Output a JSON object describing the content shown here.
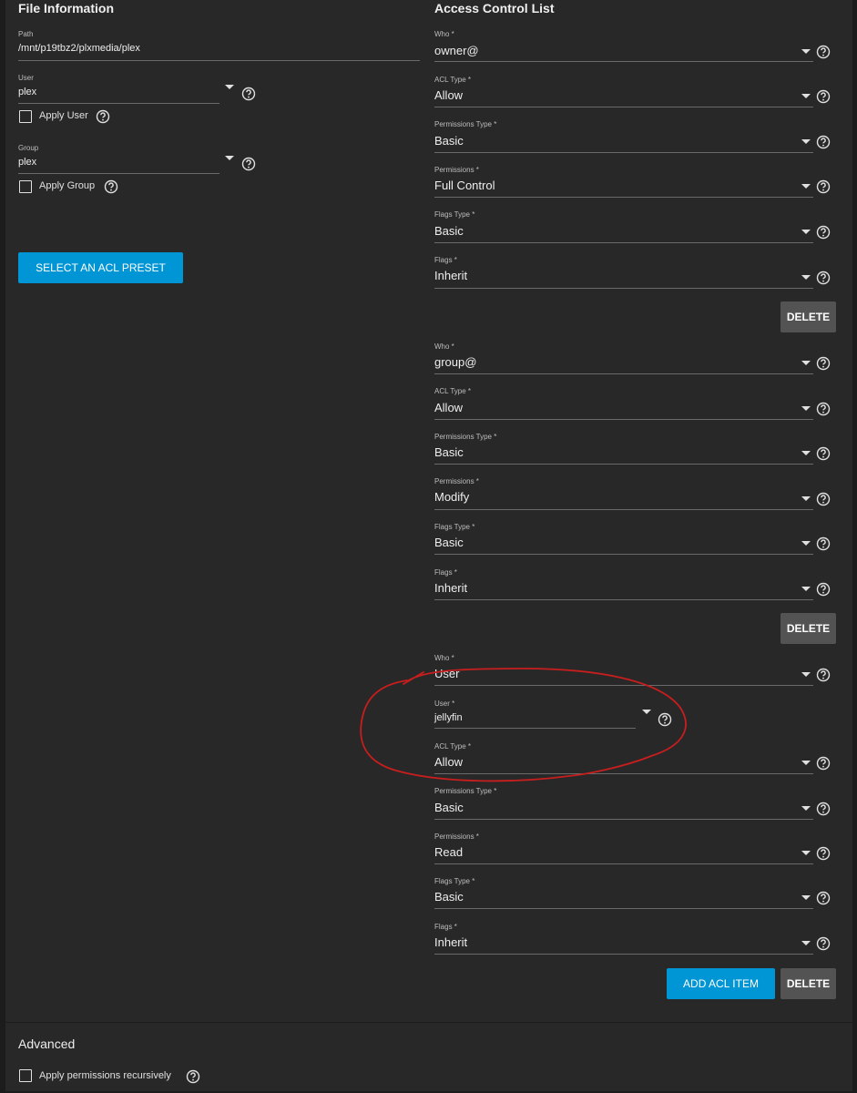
{
  "file_info": {
    "title": "File Information",
    "path_label": "Path",
    "path_value": "/mnt/p19tbz2/plxmedia/plex",
    "user_label": "User",
    "user_value": "plex",
    "apply_user_label": "Apply User",
    "group_label": "Group",
    "group_value": "plex",
    "apply_group_label": "Apply Group",
    "preset_button": "SELECT AN ACL PRESET"
  },
  "acl": {
    "title": "Access Control List",
    "entries": [
      {
        "fields": [
          {
            "label": "Who *",
            "value": "owner@"
          },
          {
            "label": "ACL Type *",
            "value": "Allow"
          },
          {
            "label": "Permissions Type *",
            "value": "Basic"
          },
          {
            "label": "Permissions *",
            "value": "Full Control"
          },
          {
            "label": "Flags Type *",
            "value": "Basic"
          },
          {
            "label": "Flags *",
            "value": "Inherit"
          }
        ],
        "delete_label": "DELETE"
      },
      {
        "fields": [
          {
            "label": "Who *",
            "value": "group@"
          },
          {
            "label": "ACL Type *",
            "value": "Allow"
          },
          {
            "label": "Permissions Type *",
            "value": "Basic"
          },
          {
            "label": "Permissions *",
            "value": "Modify"
          },
          {
            "label": "Flags Type *",
            "value": "Basic"
          },
          {
            "label": "Flags *",
            "value": "Inherit"
          }
        ],
        "delete_label": "DELETE"
      },
      {
        "fields": [
          {
            "label": "Who *",
            "value": "User"
          },
          {
            "label": "User *",
            "value": "jellyfin"
          },
          {
            "label": "ACL Type *",
            "value": "Allow"
          },
          {
            "label": "Permissions Type *",
            "value": "Basic"
          },
          {
            "label": "Permissions *",
            "value": "Read"
          },
          {
            "label": "Flags Type *",
            "value": "Basic"
          },
          {
            "label": "Flags *",
            "value": "Inherit"
          }
        ],
        "delete_label": "DELETE"
      }
    ],
    "add_button": "ADD ACL ITEM"
  },
  "advanced": {
    "title": "Advanced",
    "recursive_label": "Apply permissions recursively"
  },
  "colors": {
    "background": "#282828",
    "accent": "#0095d5",
    "delete_button": "#535353",
    "annotation": "#c81e1e"
  }
}
